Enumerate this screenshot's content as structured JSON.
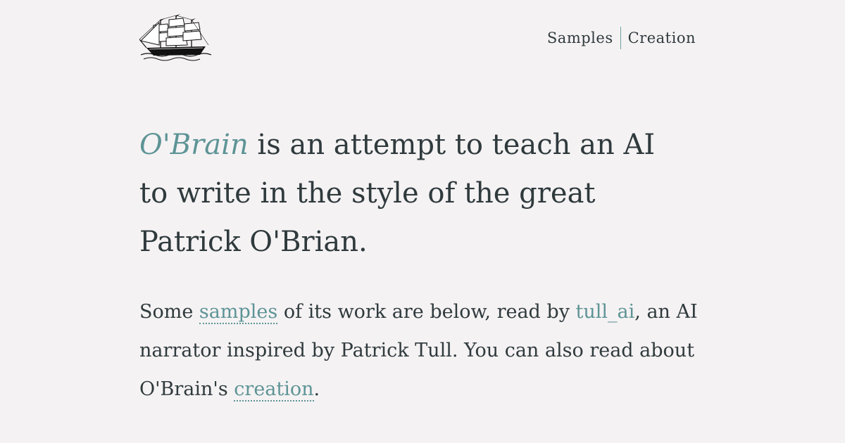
{
  "header": {
    "logo_icon": "tall-ship-icon",
    "nav": {
      "samples": "Samples",
      "creation": "Creation"
    }
  },
  "hero": {
    "brand": "O'Brain",
    "line_rest": " is an attempt to teach an AI to write in the style of the great Patrick O'Brian."
  },
  "intro": {
    "t1": "Some ",
    "link_samples": "samples",
    "t2": " of its work are below, read by ",
    "link_tull": "tull_ai",
    "t3": ", an AI narrator inspired by Patrick Tull. You can also read about O'Brain's ",
    "link_creation": "creation",
    "t4": "."
  },
  "colors": {
    "accent": "#5e9496",
    "background": "#f5f2f3",
    "text": "#2f3a3d"
  }
}
